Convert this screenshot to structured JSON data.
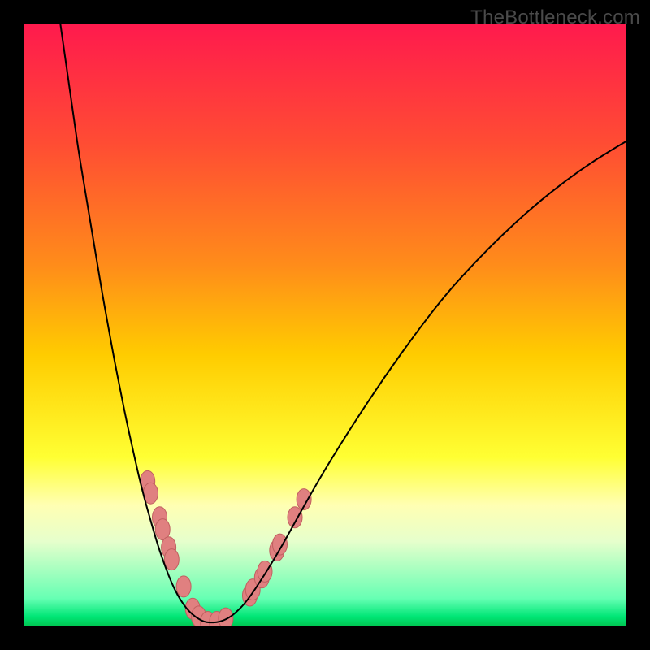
{
  "watermark": "TheBottleneck.com",
  "chart_data": {
    "type": "line",
    "title": "",
    "xlabel": "",
    "ylabel": "",
    "xlim": [
      0,
      100
    ],
    "ylim": [
      0,
      100
    ],
    "background_gradient": {
      "type": "vertical",
      "stops": [
        {
          "pos": 0.0,
          "color": "#ff1a4d"
        },
        {
          "pos": 0.2,
          "color": "#ff4d33"
        },
        {
          "pos": 0.4,
          "color": "#ff8c1a"
        },
        {
          "pos": 0.55,
          "color": "#ffcc00"
        },
        {
          "pos": 0.72,
          "color": "#ffff33"
        },
        {
          "pos": 0.8,
          "color": "#ffffb3"
        },
        {
          "pos": 0.86,
          "color": "#e6ffcc"
        },
        {
          "pos": 0.955,
          "color": "#66ffb3"
        },
        {
          "pos": 0.985,
          "color": "#00e676"
        },
        {
          "pos": 1.0,
          "color": "#00c853"
        }
      ]
    },
    "series": [
      {
        "name": "bottleneck-curve",
        "color": "#000000",
        "width": 2,
        "x": [
          6,
          7,
          8,
          9,
          10,
          11,
          12,
          13,
          14,
          15,
          16,
          17,
          18,
          19,
          20,
          21,
          22,
          23,
          24,
          25,
          26,
          27,
          28,
          29,
          30,
          31,
          32,
          33,
          34,
          35,
          37,
          40,
          43,
          46,
          50,
          55,
          60,
          65,
          70,
          75,
          80,
          85,
          90,
          95,
          100
        ],
        "y": [
          100,
          93,
          86,
          79,
          73,
          67,
          61,
          55,
          49.5,
          44,
          39,
          34,
          29.5,
          25,
          21,
          17.5,
          14,
          11,
          8.3,
          6,
          4.2,
          2.8,
          1.8,
          1.1,
          0.6,
          0.5,
          0.55,
          0.8,
          1.3,
          2,
          4,
          8.5,
          13.5,
          19,
          26,
          34,
          41.5,
          48.5,
          55,
          60.5,
          65.5,
          70,
          74,
          77.5,
          80.5
        ]
      }
    ],
    "markers": {
      "name": "data-points",
      "color": "#e08080",
      "stroke": "#c06060",
      "radius_x": 9,
      "radius_y": 13,
      "points": [
        {
          "x": 20.5,
          "y": 24.0
        },
        {
          "x": 21.0,
          "y": 22.0
        },
        {
          "x": 22.5,
          "y": 18.0
        },
        {
          "x": 23.0,
          "y": 16.0
        },
        {
          "x": 24.0,
          "y": 13.0
        },
        {
          "x": 24.5,
          "y": 11.0
        },
        {
          "x": 26.5,
          "y": 6.5
        },
        {
          "x": 28.0,
          "y": 2.8
        },
        {
          "x": 29.0,
          "y": 1.5
        },
        {
          "x": 30.5,
          "y": 0.6
        },
        {
          "x": 32.0,
          "y": 0.6
        },
        {
          "x": 33.5,
          "y": 1.2
        },
        {
          "x": 37.5,
          "y": 5.0
        },
        {
          "x": 38.0,
          "y": 6.0
        },
        {
          "x": 39.5,
          "y": 8.0
        },
        {
          "x": 40.0,
          "y": 9.0
        },
        {
          "x": 42.0,
          "y": 12.5
        },
        {
          "x": 42.5,
          "y": 13.5
        },
        {
          "x": 45.0,
          "y": 18.0
        },
        {
          "x": 46.5,
          "y": 21.0
        }
      ]
    }
  }
}
